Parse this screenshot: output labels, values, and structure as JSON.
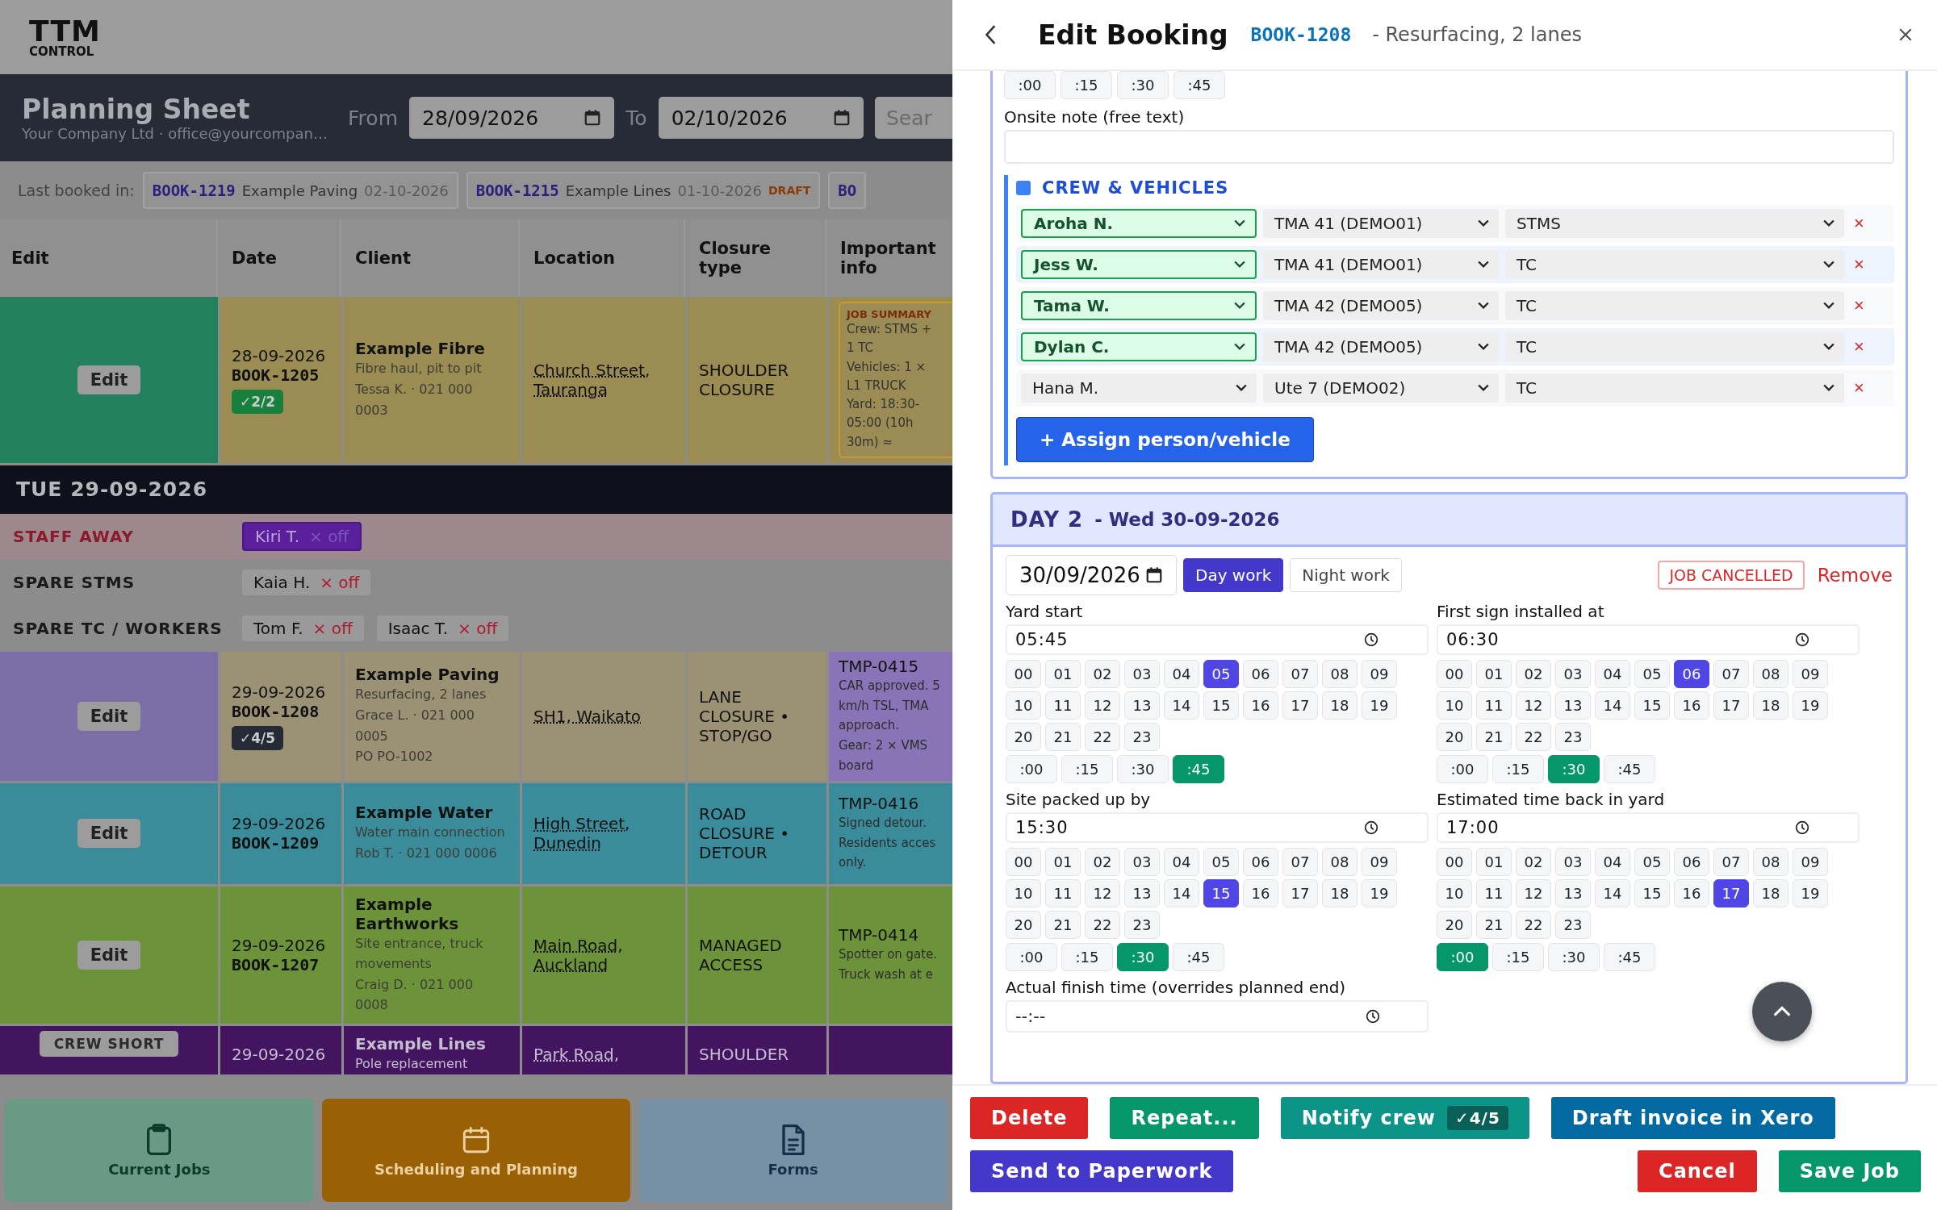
{
  "logo": {
    "top": "TTM",
    "bottom": "CONTROL"
  },
  "header": {
    "title": "Planning Sheet",
    "subtitle": "Your Company Ltd · office@yourcompan…",
    "from_label": "From",
    "from": "28/09/2026",
    "to_label": "To",
    "to": "02/10/2026",
    "search": {
      "placeholder": "Sear"
    }
  },
  "last_booked": {
    "label": "Last booked in:",
    "chips": [
      {
        "code": "BOOK-1219",
        "name": "Example Paving",
        "date": "02-10-2026"
      },
      {
        "code": "BOOK-1215",
        "name": "Example Lines",
        "date": "01-10-2026",
        "badge": "DRAFT"
      },
      {
        "code": "BO"
      }
    ]
  },
  "table": {
    "columns": [
      "Edit",
      "Date",
      "Client",
      "Location",
      "Closure type",
      "Important info"
    ],
    "rows": [
      {
        "edit": "Edit",
        "kind": "confirmed",
        "color": "#9a8c52",
        "date": "28-09-2026",
        "code": "BOOK-1205",
        "crew": {
          "text": "✓2/2",
          "complete": true
        },
        "client": "Example Fibre",
        "details": [
          "Fibre haul, pit to pit",
          "Tessa K. · 021 000 0003"
        ],
        "location": "Church Street, Tauranga",
        "closure": "SHOULDER CLOSURE",
        "info": {
          "kind": "summary",
          "title": "JOB SUMMARY",
          "lines": [
            "Crew: STMS +",
            "1 TC",
            "Vehicles: 1 ×",
            "L1 TRUCK",
            "Yard: 18:30-",
            "05:00 (10h",
            "30m) ≈"
          ]
        }
      }
    ]
  },
  "day": {
    "label": "TUE 29-09-2026",
    "staff": [
      {
        "label": "STAFF AWAY",
        "kind": "away",
        "chips": [
          {
            "name": "Kiri T.",
            "off": "× off"
          }
        ]
      },
      {
        "label": "SPARE STMS",
        "kind": "spare",
        "chips": [
          {
            "name": "Kaia H.",
            "off": "× off"
          }
        ]
      },
      {
        "label": "SPARE TC / WORKERS",
        "kind": "spare",
        "chips": [
          {
            "name": "Tom F.",
            "off": "× off"
          },
          {
            "name": "Isaac T.",
            "off": "× off"
          }
        ]
      }
    ],
    "rows": [
      {
        "edit": "Edit",
        "kind": "pending",
        "color": "#9b9276",
        "date": "29-09-2026",
        "code": "BOOK-1208",
        "crew": {
          "text": "✓4/5",
          "complete": false
        },
        "client": "Example Paving",
        "details": [
          "Resurfacing, 2 lanes",
          "Grace L. · 021 000 0005",
          "PO PO-1002"
        ],
        "location": "SH1, Waikato",
        "closure": "LANE CLOSURE • STOP/GO",
        "info": {
          "kind": "plain",
          "title": "TMP-0415",
          "lines": [
            "CAR approved. 5",
            "km/h TSL, TMA",
            "approach.",
            "Gear: 2 × VMS",
            "board"
          ]
        }
      },
      {
        "edit": "Edit",
        "kind": "plain",
        "color": "#3a8c9a",
        "date": "29-09-2026",
        "code": "BOOK-1209",
        "client": "Example Water",
        "details": [
          "Water main connection",
          "Rob T. · 021 000 0006"
        ],
        "location": "High Street, Dunedin",
        "closure": "ROAD CLOSURE • DETOUR",
        "info": {
          "kind": "plain",
          "title": "TMP-0416",
          "lines": [
            "Signed detour.",
            "Residents acces",
            "only."
          ]
        }
      },
      {
        "edit": "Edit",
        "kind": "plain",
        "color": "#6d933a",
        "date": "29-09-2026",
        "code": "BOOK-1207",
        "client": "Example Earthworks",
        "details": [
          "Site entrance, truck movements",
          "Craig D. · 021 000 0008"
        ],
        "location": "Main Road, Auckland",
        "closure": "MANAGED ACCESS",
        "info": {
          "kind": "plain",
          "title": "TMP-0414",
          "lines": [
            "Spotter on gate.",
            "Truck wash at e"
          ]
        }
      },
      {
        "flag": "CREW SHORT",
        "kind": "plain",
        "color": "#43145f",
        "date": "29-09-2026",
        "client": "Example Lines",
        "details": [
          "Pole replacement"
        ],
        "location": "Park Road,",
        "closure": "SHOULDER"
      }
    ]
  },
  "nav": [
    {
      "label": "Current Jobs",
      "selected": false
    },
    {
      "label": "Scheduling and Planning",
      "selected": true
    },
    {
      "label": "Forms",
      "selected": false
    }
  ],
  "drawer": {
    "title": "Edit Booking",
    "code": "BOOK-1208",
    "subtitle": "- Resurfacing, 2 lanes",
    "day1": {
      "minutes": [
        {
          "label": ":00",
          "selected": false
        },
        {
          "label": ":15",
          "selected": false
        },
        {
          "label": ":30",
          "selected": false
        },
        {
          "label": ":45",
          "selected": false
        }
      ],
      "note": {
        "label": "Onsite note (free text)"
      },
      "crew_title": "CREW & VEHICLES",
      "crew": [
        {
          "person": "Aroha N.",
          "vehicle": "TMA 41 (DEMO01)",
          "role": "STMS",
          "confirmed": true,
          "remove": "×"
        },
        {
          "person": "Jess W.",
          "vehicle": "TMA 41 (DEMO01)",
          "role": "TC",
          "confirmed": true,
          "remove": "×"
        },
        {
          "person": "Tama W.",
          "vehicle": "TMA 42 (DEMO05)",
          "role": "TC",
          "confirmed": true,
          "remove": "×"
        },
        {
          "person": "Dylan C.",
          "vehicle": "TMA 42 (DEMO05)",
          "role": "TC",
          "confirmed": true,
          "remove": "×"
        },
        {
          "person": "Hana M.",
          "vehicle": "Ute 7 (DEMO02)",
          "role": "TC",
          "confirmed": false,
          "remove": "×"
        }
      ],
      "assign": "+ Assign person/vehicle"
    },
    "day2": {
      "label": "DAY 2",
      "date_text": "- Wed 30-09-2026",
      "date": "30/09/2026",
      "modes": [
        {
          "label": "Day work",
          "selected": true
        },
        {
          "label": "Night work",
          "selected": false
        }
      ],
      "cancelled": {
        "label": "JOB CANCELLED",
        "on": false
      },
      "remove": "Remove",
      "times": [
        {
          "label": "Yard start",
          "value": "05:45",
          "hours": [
            {
              "label": "00",
              "selected": false
            },
            {
              "label": "01",
              "selected": false
            },
            {
              "label": "02",
              "selected": false
            },
            {
              "label": "03",
              "selected": false
            },
            {
              "label": "04",
              "selected": false
            },
            {
              "label": "05",
              "selected": true
            },
            {
              "label": "06",
              "selected": false
            },
            {
              "label": "07",
              "selected": false
            },
            {
              "label": "08",
              "selected": false
            },
            {
              "label": "09",
              "selected": false
            },
            {
              "label": "10",
              "selected": false
            },
            {
              "label": "11",
              "selected": false
            },
            {
              "label": "12",
              "selected": false
            },
            {
              "label": "13",
              "selected": false
            },
            {
              "label": "14",
              "selected": false
            },
            {
              "label": "15",
              "selected": false
            },
            {
              "label": "16",
              "selected": false
            },
            {
              "label": "17",
              "selected": false
            },
            {
              "label": "18",
              "selected": false
            },
            {
              "label": "19",
              "selected": false
            },
            {
              "label": "20",
              "selected": false
            },
            {
              "label": "21",
              "selected": false
            },
            {
              "label": "22",
              "selected": false
            },
            {
              "label": "23",
              "selected": false
            }
          ],
          "minutes": [
            {
              "label": ":00",
              "selected": false
            },
            {
              "label": ":15",
              "selected": false
            },
            {
              "label": ":30",
              "selected": false
            },
            {
              "label": ":45",
              "selected": true
            }
          ]
        },
        {
          "label": "First sign installed at",
          "value": "06:30",
          "hours": [
            {
              "label": "00",
              "selected": false
            },
            {
              "label": "01",
              "selected": false
            },
            {
              "label": "02",
              "selected": false
            },
            {
              "label": "03",
              "selected": false
            },
            {
              "label": "04",
              "selected": false
            },
            {
              "label": "05",
              "selected": false
            },
            {
              "label": "06",
              "selected": true
            },
            {
              "label": "07",
              "selected": false
            },
            {
              "label": "08",
              "selected": false
            },
            {
              "label": "09",
              "selected": false
            },
            {
              "label": "10",
              "selected": false
            },
            {
              "label": "11",
              "selected": false
            },
            {
              "label": "12",
              "selected": false
            },
            {
              "label": "13",
              "selected": false
            },
            {
              "label": "14",
              "selected": false
            },
            {
              "label": "15",
              "selected": false
            },
            {
              "label": "16",
              "selected": false
            },
            {
              "label": "17",
              "selected": false
            },
            {
              "label": "18",
              "selected": false
            },
            {
              "label": "19",
              "selected": false
            },
            {
              "label": "20",
              "selected": false
            },
            {
              "label": "21",
              "selected": false
            },
            {
              "label": "22",
              "selected": false
            },
            {
              "label": "23",
              "selected": false
            }
          ],
          "minutes": [
            {
              "label": ":00",
              "selected": false
            },
            {
              "label": ":15",
              "selected": false
            },
            {
              "label": ":30",
              "selected": true
            },
            {
              "label": ":45",
              "selected": false
            }
          ]
        },
        {
          "label": "Site packed up by",
          "value": "15:30",
          "hours": [
            {
              "label": "00",
              "selected": false
            },
            {
              "label": "01",
              "selected": false
            },
            {
              "label": "02",
              "selected": false
            },
            {
              "label": "03",
              "selected": false
            },
            {
              "label": "04",
              "selected": false
            },
            {
              "label": "05",
              "selected": false
            },
            {
              "label": "06",
              "selected": false
            },
            {
              "label": "07",
              "selected": false
            },
            {
              "label": "08",
              "selected": false
            },
            {
              "label": "09",
              "selected": false
            },
            {
              "label": "10",
              "selected": false
            },
            {
              "label": "11",
              "selected": false
            },
            {
              "label": "12",
              "selected": false
            },
            {
              "label": "13",
              "selected": false
            },
            {
              "label": "14",
              "selected": false
            },
            {
              "label": "15",
              "selected": true
            },
            {
              "label": "16",
              "selected": false
            },
            {
              "label": "17",
              "selected": false
            },
            {
              "label": "18",
              "selected": false
            },
            {
              "label": "19",
              "selected": false
            },
            {
              "label": "20",
              "selected": false
            },
            {
              "label": "21",
              "selected": false
            },
            {
              "label": "22",
              "selected": false
            },
            {
              "label": "23",
              "selected": false
            }
          ],
          "minutes": [
            {
              "label": ":00",
              "selected": false
            },
            {
              "label": ":15",
              "selected": false
            },
            {
              "label": ":30",
              "selected": true
            },
            {
              "label": ":45",
              "selected": false
            }
          ]
        },
        {
          "label": "Estimated time back in yard",
          "value": "17:00",
          "hours": [
            {
              "label": "00",
              "selected": false
            },
            {
              "label": "01",
              "selected": false
            },
            {
              "label": "02",
              "selected": false
            },
            {
              "label": "03",
              "selected": false
            },
            {
              "label": "04",
              "selected": false
            },
            {
              "label": "05",
              "selected": false
            },
            {
              "label": "06",
              "selected": false
            },
            {
              "label": "07",
              "selected": false
            },
            {
              "label": "08",
              "selected": false
            },
            {
              "label": "09",
              "selected": false
            },
            {
              "label": "10",
              "selected": false
            },
            {
              "label": "11",
              "selected": false
            },
            {
              "label": "12",
              "selected": false
            },
            {
              "label": "13",
              "selected": false
            },
            {
              "label": "14",
              "selected": false
            },
            {
              "label": "15",
              "selected": false
            },
            {
              "label": "16",
              "selected": false
            },
            {
              "label": "17",
              "selected": true
            },
            {
              "label": "18",
              "selected": false
            },
            {
              "label": "19",
              "selected": false
            },
            {
              "label": "20",
              "selected": false
            },
            {
              "label": "21",
              "selected": false
            },
            {
              "label": "22",
              "selected": false
            },
            {
              "label": "23",
              "selected": false
            }
          ],
          "minutes": [
            {
              "label": ":00",
              "selected": true
            },
            {
              "label": ":15",
              "selected": false
            },
            {
              "label": ":30",
              "selected": false
            },
            {
              "label": ":45",
              "selected": false
            }
          ]
        }
      ],
      "finish": {
        "label": "Actual finish time (overrides planned end)",
        "placeholder": "--:--"
      }
    },
    "actions": [
      {
        "label": "Delete",
        "color": "#dc2626"
      },
      {
        "label": "Repeat...",
        "color": "#059669"
      },
      {
        "label": "Notify crew",
        "badge": "✓4/5",
        "color": "#0d9488"
      },
      {
        "label": "Draft invoice in Xero",
        "color": "#0369a1"
      }
    ],
    "actions_bottom": [
      {
        "label": "Send to Paperwork",
        "color": "#4338ca"
      },
      {
        "label": "Cancel",
        "color": "#dc2626"
      },
      {
        "label": "Save Job",
        "color": "#059669"
      }
    ]
  }
}
